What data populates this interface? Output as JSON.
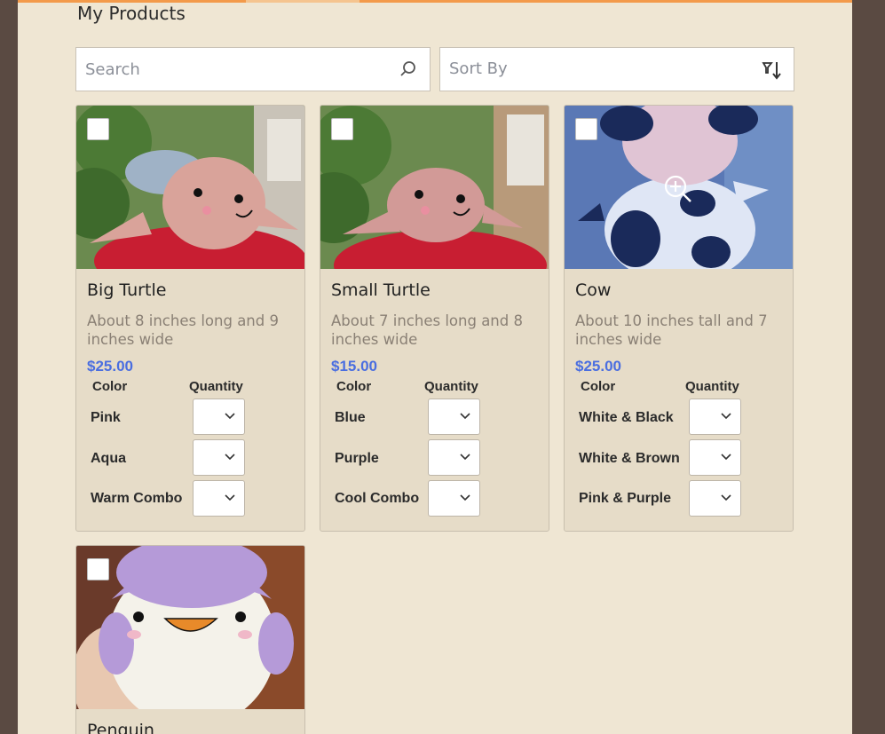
{
  "page": {
    "title": "My Products"
  },
  "search": {
    "placeholder": "Search"
  },
  "sort": {
    "label": "Sort By"
  },
  "table_headers": {
    "color": "Color",
    "quantity": "Quantity"
  },
  "products": [
    {
      "name": "Big Turtle",
      "description": "About 8 inches long and 9 inches wide",
      "price": "$25.00",
      "options": [
        "Pink",
        "Aqua",
        "Warm Combo"
      ]
    },
    {
      "name": "Small Turtle",
      "description": "About 7 inches long and 8 inches wide",
      "price": "$15.00",
      "options": [
        "Blue",
        "Purple",
        "Cool Combo"
      ]
    },
    {
      "name": "Cow",
      "description": "About 10 inches tall and 7 inches wide",
      "price": "$25.00",
      "options": [
        "White & Black",
        "White & Brown",
        "Pink & Purple"
      ]
    },
    {
      "name": "Penguin"
    }
  ],
  "colors": {
    "price": "#4a6ee0",
    "panel": "#efe6d3",
    "card": "#e6dcc8",
    "progress": "#f08a2a"
  }
}
